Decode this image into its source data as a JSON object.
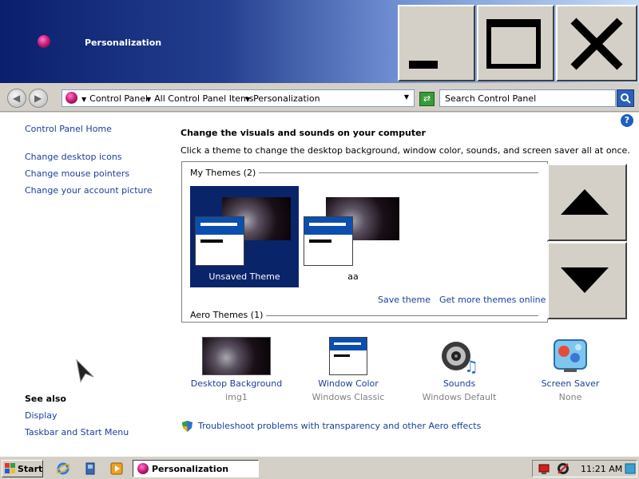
{
  "window": {
    "title": "Personalization"
  },
  "address_bar": {
    "crumbs": [
      "Control Panel",
      "All Control Panel Items",
      "Personalization"
    ],
    "search_placeholder": "Search Control Panel"
  },
  "sidebar": {
    "home_link": "Control Panel Home",
    "links": [
      "Change desktop icons",
      "Change mouse pointers",
      "Change your account picture"
    ],
    "see_also_heading": "See also",
    "see_also_links": [
      "Display",
      "Taskbar and Start Menu"
    ]
  },
  "main": {
    "title": "Change the visuals and sounds on your computer",
    "description": "Click a theme to change the desktop background, window color, sounds, and screen saver all at once.",
    "my_themes_label": "My Themes (2)",
    "aero_themes_label": "Aero Themes (1)",
    "themes": [
      {
        "name": "Unsaved Theme",
        "selected": true
      },
      {
        "name": "aa",
        "selected": false
      }
    ],
    "save_theme": "Save theme",
    "get_more_themes": "Get more themes online",
    "bottom_items": [
      {
        "label": "Desktop Background",
        "sub": "img1",
        "icon": "desktop-background-icon"
      },
      {
        "label": "Window Color",
        "sub": "Windows Classic",
        "icon": "window-color-icon"
      },
      {
        "label": "Sounds",
        "sub": "Windows Default",
        "icon": "sounds-icon"
      },
      {
        "label": "Screen Saver",
        "sub": "None",
        "icon": "screen-saver-icon"
      }
    ],
    "troubleshoot": "Troubleshoot problems with transparency and other Aero effects"
  },
  "taskbar": {
    "start_label": "Start",
    "active_task": "Personalization",
    "clock": "11:21 AM"
  }
}
